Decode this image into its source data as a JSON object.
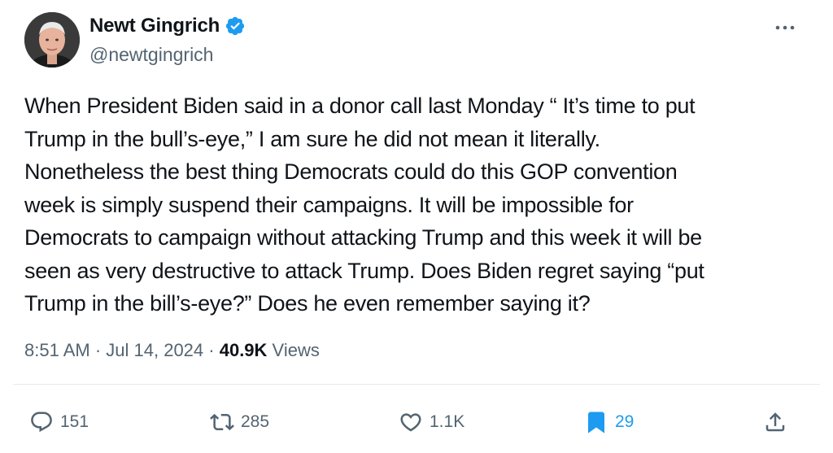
{
  "author": {
    "name": "Newt Gingrich",
    "handle": "@newtgingrich",
    "verified": true
  },
  "tweet": {
    "lines": [
      "When President Biden said in a donor call last Monday “ It’s time to put",
      "Trump in the bull’s-eye,” I am sure he did not mean it literally.",
      "Nonetheless the best thing Democrats could do this GOP convention",
      "week is simply suspend their campaigns. It will be impossible for",
      "Democrats to campaign without attacking Trump and this week it will be",
      "seen as very destructive to attack Trump. Does Biden regret saying “put",
      "Trump in the bill’s-eye?” Does he even remember saying it?"
    ]
  },
  "meta": {
    "time": "8:51 AM",
    "separator": " · ",
    "date": "Jul 14, 2024",
    "views_count": "40.9K",
    "views_label": " Views"
  },
  "actions": {
    "reply_count": "151",
    "retweet_count": "285",
    "like_count": "1.1K",
    "bookmark_count": "29"
  },
  "icons": {
    "verified": "verified-badge-icon",
    "more": "more-dots-icon",
    "reply": "reply-bubble-icon",
    "retweet": "retweet-icon",
    "like": "heart-icon",
    "bookmark": "bookmark-icon",
    "share": "share-icon"
  },
  "colors": {
    "accent": "#1d9bf0",
    "text": "#0f1419",
    "secondary": "#536471"
  }
}
